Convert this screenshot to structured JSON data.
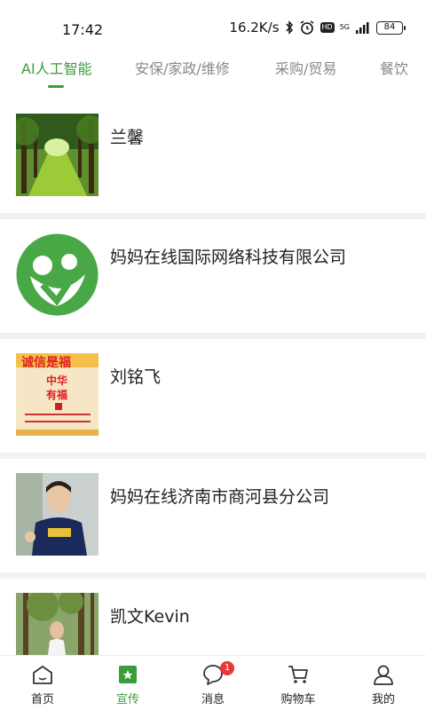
{
  "status_bar": {
    "time": "17:42",
    "net_speed": "16.2K/s",
    "hd": "HD",
    "network": "5G",
    "battery": "84"
  },
  "tabs": [
    {
      "label": "AI人工智能",
      "active": true
    },
    {
      "label": "安保/家政/维修",
      "active": false
    },
    {
      "label": "采购/贸易",
      "active": false
    },
    {
      "label": "餐饮",
      "active": false
    }
  ],
  "items": [
    {
      "title": "兰馨",
      "image": "forest-path-photo"
    },
    {
      "title": "妈妈在线国际网络科技有限公司",
      "image": "green-logo"
    },
    {
      "title": "刘铭飞",
      "image": "calligraphy-poster",
      "image_text": [
        "诚信是福",
        "中华",
        "有福"
      ]
    },
    {
      "title": "妈妈在线济南市商河县分公司",
      "image": "person-photo"
    },
    {
      "title": "凯文Kevin",
      "image": "person-forest-photo"
    }
  ],
  "bottom_nav": [
    {
      "label": "首页",
      "icon": "home-icon"
    },
    {
      "label": "宣传",
      "icon": "promo-icon",
      "active": true
    },
    {
      "label": "消息",
      "icon": "message-icon",
      "badge": "1"
    },
    {
      "label": "购物车",
      "icon": "cart-icon"
    },
    {
      "label": "我的",
      "icon": "profile-icon"
    }
  ],
  "colors": {
    "accent": "#3a9d3a",
    "badge": "#e53935"
  }
}
